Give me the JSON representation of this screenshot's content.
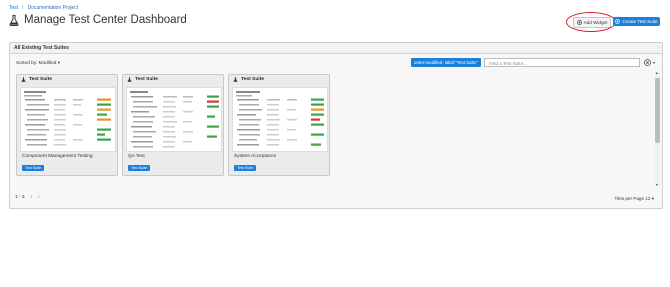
{
  "breadcrumb": {
    "items": [
      "Test",
      "Documentation Project"
    ]
  },
  "header": {
    "title": "Manage Test Center Dashboard"
  },
  "actions": {
    "add_widget": "Add Widget",
    "create_test_suite": "Create Test Suite"
  },
  "panel": {
    "title": "All Existing Test Suites",
    "sort_label": "Sorted by: Modified",
    "filter_chip": "order:modified- label:\"Test Suite\"",
    "search_placeholder": "Find a Test Suite...",
    "tiles": [
      {
        "type": "Test Suite",
        "name": "Component Management Testing",
        "badge": "Test Suite"
      },
      {
        "type": "Test Suite",
        "name": "QA Test",
        "badge": "Test Suite"
      },
      {
        "type": "Test Suite",
        "name": "System Acceptance",
        "badge": "Test Suite"
      }
    ],
    "pagination": {
      "range": "1 - 3"
    },
    "tiles_per_page": {
      "label": "Tiles per Page",
      "value": "12"
    }
  },
  "colors": {
    "primary": "#1c7fd8",
    "highlight": "#d8182a",
    "link": "#2a6fb5"
  },
  "icons": [
    "flask-icon",
    "plus-circle-icon",
    "clear-icon",
    "chevron-left-icon",
    "chevron-right-icon"
  ]
}
